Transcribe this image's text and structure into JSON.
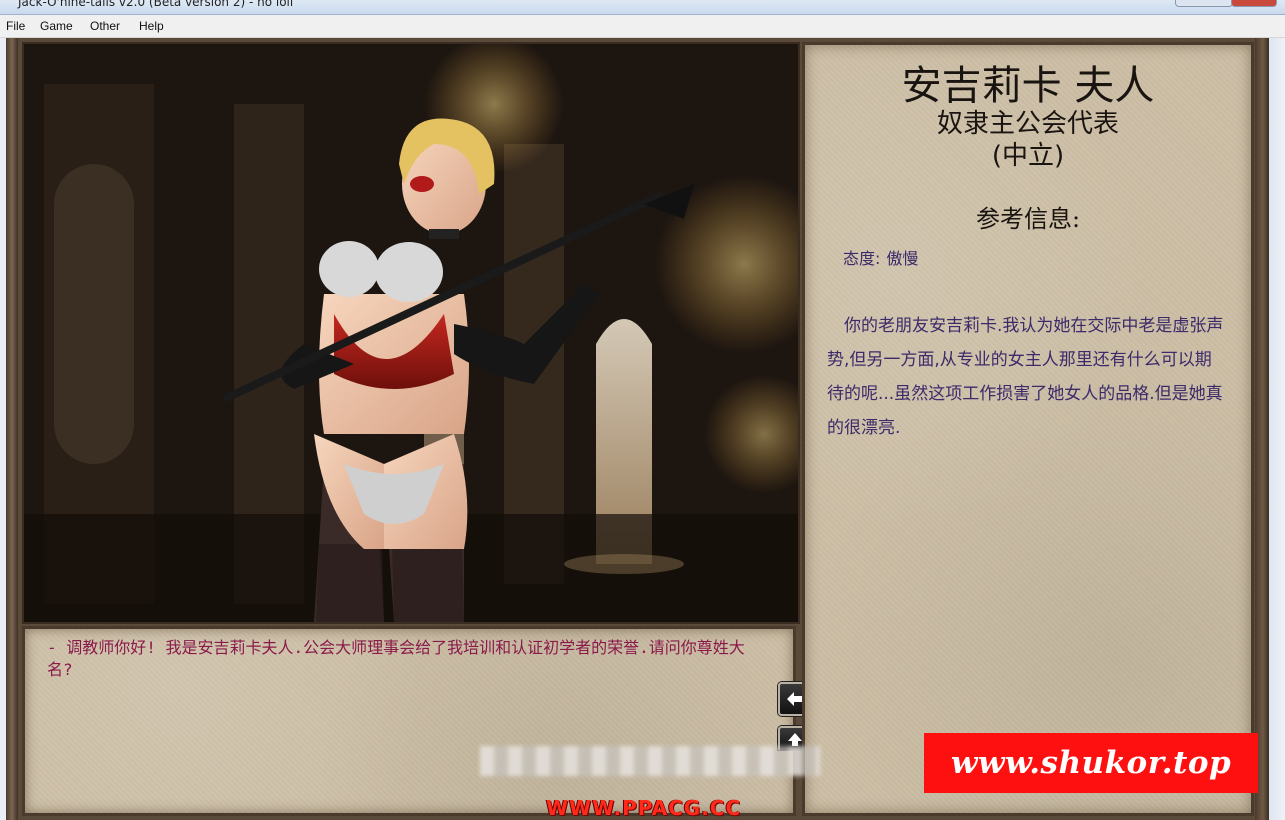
{
  "window": {
    "title": "Jack-O'nine-tails v2.0 (Beta version 2) - no loli"
  },
  "menu": {
    "items": [
      "File",
      "Game",
      "Other",
      "Help"
    ]
  },
  "character": {
    "name": "安吉莉卡 夫人",
    "title": "奴隶主公会代表",
    "alignment": "(中立)",
    "ref_heading": "参考信息:",
    "attitude_label": "态度:",
    "attitude_value": "傲慢",
    "description": "你的老朋友安吉莉卡.我认为她在交际中老是虚张声势,但另一方面,从专业的女主人那里还有什么可以期待的呢...虽然这项工作损害了她女人的品格.但是她真的很漂亮."
  },
  "dialogue": {
    "text": "- 调教师你好! 我是安吉莉卡夫人.公会大师理事会给了我培训和认证初学者的荣誉.请问你尊姓大名?"
  },
  "nav": {
    "back_icon": "arrow-left-icon",
    "next_icon": "arrow-up-icon"
  },
  "watermarks": {
    "site_a": "www.shukor.top",
    "site_b": "WWW.PPACG.CC"
  },
  "colors": {
    "dialogue_text": "#8a1a4a",
    "info_text": "#3c2a6a",
    "parchment": "#cdbfa6",
    "watermark_red": "#ff1010"
  }
}
